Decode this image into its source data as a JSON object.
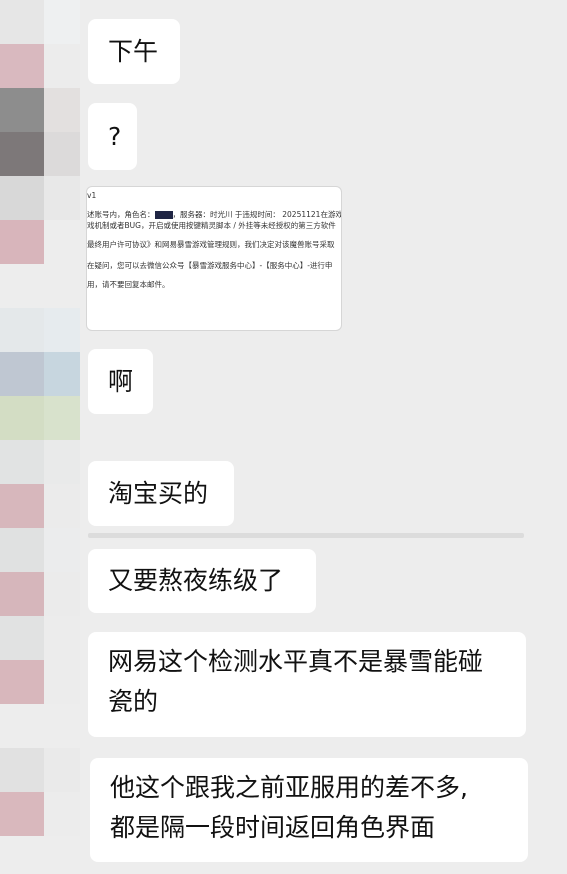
{
  "messages": {
    "afternoon": "下午",
    "question": "?",
    "ah": "啊",
    "taobao": "淘宝买的",
    "level_again": "又要熬夜练级了",
    "netease_line1": "网易这个检测水平真不是暴雪能碰",
    "netease_line2": "瓷的",
    "similar_line1": "他这个跟我之前亚服用的差不多,",
    "similar_line2": "都是隔一段时间返回角色界面"
  },
  "screenshot": {
    "line1": "v1",
    "line2a": "述账号内，角色名：",
    "line2b": "，服务器：时光川 于违规时间： 20251121在游戏",
    "line3": "戏机制或者BUG，开启或使用按键精灵脚本 / 外挂等未经授权的第三方软件",
    "line4": "最终用户许可协议》和网易暴雪游戏管理规则，我们决定对该魔兽账号采取",
    "line5": "在疑问，您可以去微信公众号【暴雪游戏服务中心】-【服务中心】-进行申",
    "line6": "用，请不要回复本邮件。"
  },
  "colors": {
    "background": "#ededed",
    "bubble": "#ffffff",
    "avatar_pink": "#d8b5bb",
    "avatar_gray_dark": "#8e8e8e",
    "avatar_blue": "#c3ccd6",
    "avatar_green": "#d6dfc8"
  }
}
